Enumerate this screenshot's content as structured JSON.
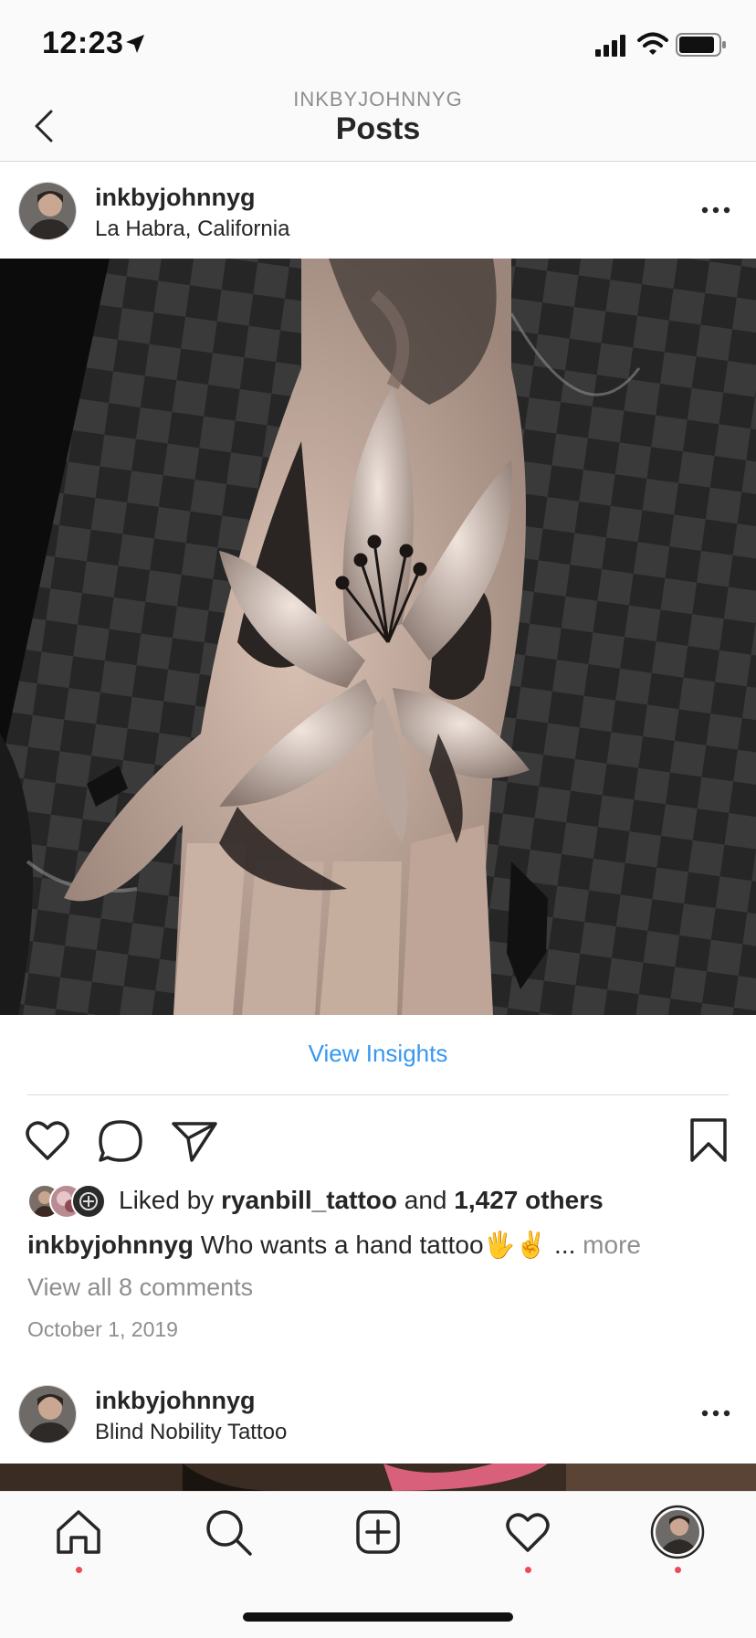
{
  "status_bar": {
    "time": "12:23"
  },
  "nav": {
    "subtitle": "INKBYJOHNNYG",
    "title": "Posts"
  },
  "post": {
    "username": "inkbyjohnnyg",
    "location": "La Habra, California",
    "view_insights": "View Insights",
    "likes": {
      "prefix": "Liked by",
      "user": "ryanbill_tattoo",
      "middle": "and",
      "others": "1,427 others"
    },
    "caption": {
      "username": "inkbyjohnnyg",
      "text": "Who wants a hand tattoo",
      "emoji": "🖐✌",
      "ellipsis": "...",
      "more": "more"
    },
    "comments_link": "View all 8 comments",
    "date": "October 1, 2019"
  },
  "next_post": {
    "username": "inkbyjohnnyg",
    "location": "Blind Nobility Tattoo"
  },
  "tab_bar": {
    "items": [
      "home-icon",
      "search-icon",
      "new-post-icon",
      "activity-heart-icon",
      "profile-avatar"
    ],
    "notification_dot_color": "#ed4956"
  },
  "colors": {
    "link_blue": "#3897f0",
    "text": "#262626",
    "muted": "#8e8e8e"
  }
}
